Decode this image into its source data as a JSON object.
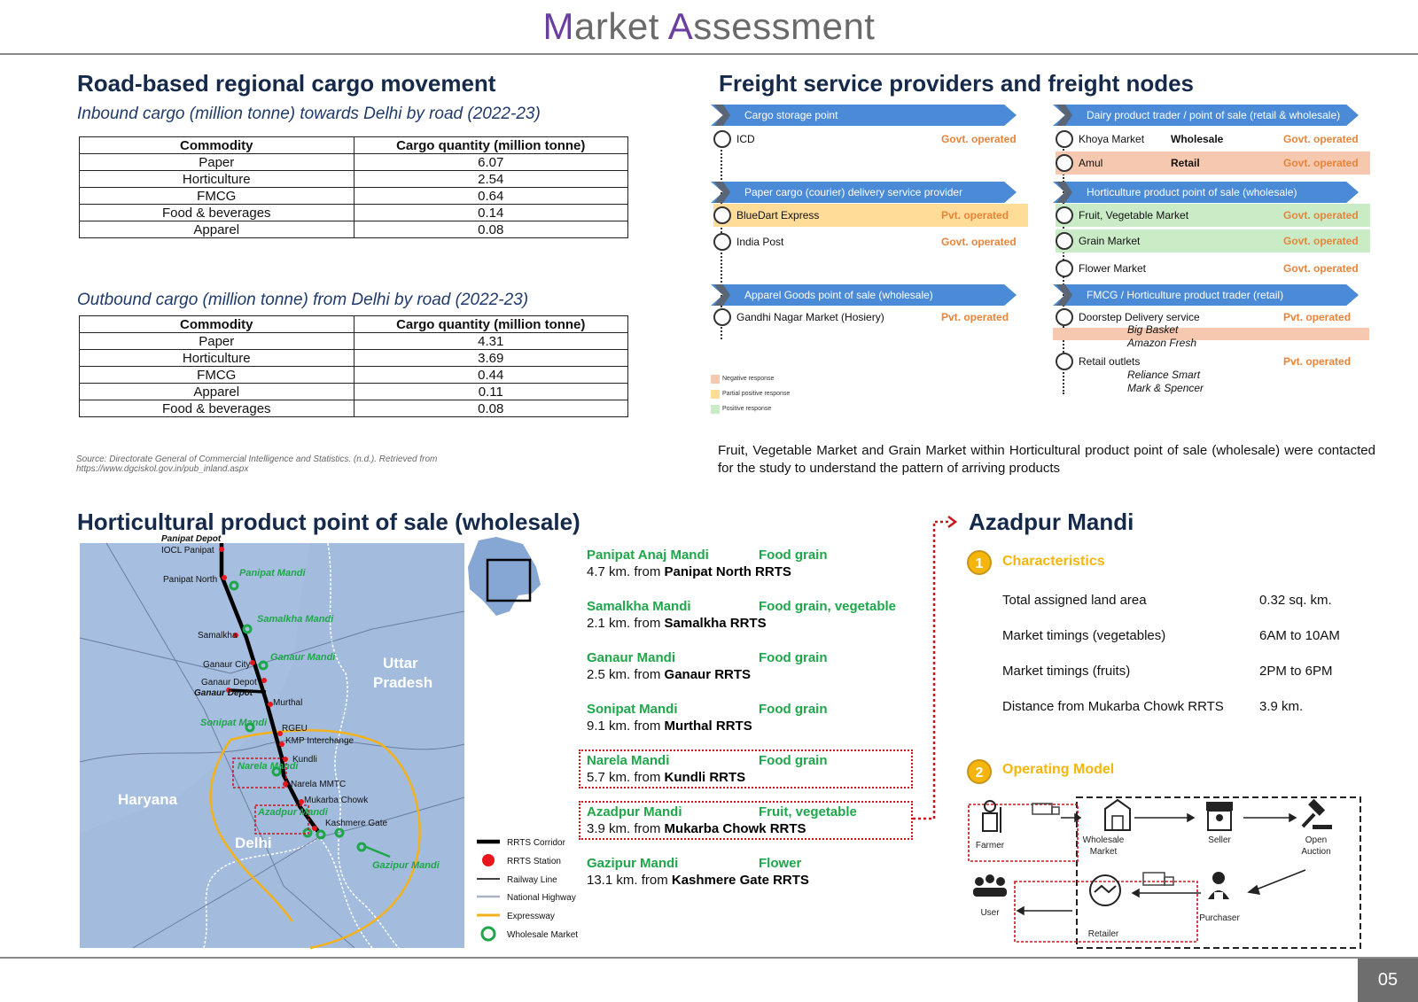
{
  "title": {
    "first_cap": "M",
    "first_rest": "arket ",
    "second_cap": "A",
    "second_rest": "ssessment"
  },
  "road_section": {
    "heading": "Road-based regional cargo movement",
    "inbound": {
      "subtitle": "Inbound cargo (million tonne) towards Delhi by road (2022-23)",
      "headers": [
        "Commodity",
        "Cargo quantity (million tonne)"
      ],
      "rows": [
        [
          "Paper",
          "6.07"
        ],
        [
          "Horticulture",
          "2.54"
        ],
        [
          "FMCG",
          "0.64"
        ],
        [
          "Food & beverages",
          "0.14"
        ],
        [
          "Apparel",
          "0.08"
        ]
      ]
    },
    "outbound": {
      "subtitle": "Outbound cargo (million tonne) from Delhi by road (2022-23)",
      "headers": [
        "Commodity",
        "Cargo quantity (million tonne)"
      ],
      "rows": [
        [
          "Paper",
          "4.31"
        ],
        [
          "Horticulture",
          "3.69"
        ],
        [
          "FMCG",
          "0.44"
        ],
        [
          "Apparel",
          "0.11"
        ],
        [
          "Food & beverages",
          "0.08"
        ]
      ]
    },
    "source_line1": "Source: Directorate General of Commercial Intelligence and Statistics. (n.d.). Retrieved from",
    "source_line2": "https://www.dgciskol.gov.in/pub_inland.aspx"
  },
  "freight": {
    "heading": "Freight service providers and freight nodes",
    "left_groups": [
      {
        "band": "Cargo storage point",
        "nodes": [
          {
            "name": "ICD",
            "op": "Govt. operated",
            "hl": ""
          }
        ]
      },
      {
        "band": "Paper cargo (courier) delivery service provider",
        "nodes": [
          {
            "name": "BlueDart Express",
            "op": "Pvt. operated",
            "hl": "#ffdd99"
          },
          {
            "name": "India Post",
            "op": "Govt. operated",
            "hl": ""
          }
        ]
      },
      {
        "band": "Apparel Goods point of sale (wholesale)",
        "nodes": [
          {
            "name": "Gandhi Nagar Market (Hosiery)",
            "op": "Pvt. operated",
            "hl": ""
          }
        ]
      }
    ],
    "right_groups": [
      {
        "band": "Dairy product trader / point of sale (retail & wholesale)",
        "nodes": [
          {
            "name": "Khoya Market",
            "mid": "Wholesale",
            "op": "Govt. operated",
            "hl": ""
          },
          {
            "name": "Amul",
            "mid": "Retail",
            "op": "Govt. operated",
            "hl": "#f6c8b0"
          }
        ]
      },
      {
        "band": "Horticulture product point of sale (wholesale)",
        "nodes": [
          {
            "name": "Fruit, Vegetable Market",
            "op": "Govt. operated",
            "hl": "#c9ecc7"
          },
          {
            "name": "Grain Market",
            "op": "Govt. operated",
            "hl": "#c9ecc7"
          },
          {
            "name": "Flower Market",
            "op": "Govt. operated",
            "hl": ""
          }
        ]
      },
      {
        "band": "FMCG / Horticulture product trader (retail)",
        "nodes": [
          {
            "name": "Doorstep Delivery service",
            "op": "Pvt. operated",
            "hl": ""
          },
          {
            "name": "Retail outlets",
            "op": "Pvt. operated",
            "hl": ""
          }
        ]
      }
    ],
    "doorstep_examples": [
      "Big Basket",
      "Amazon Fresh"
    ],
    "retail_examples": [
      "Reliance Smart",
      "Mark & Spencer"
    ],
    "legend": [
      {
        "label": "Negative response",
        "color": "#f6c8b0"
      },
      {
        "label": "Partial positive response",
        "color": "#ffdd99"
      },
      {
        "label": "Positive response",
        "color": "#c9ecc7"
      }
    ],
    "note": "Fruit, Vegetable Market and Grain Market within Horticultural product point of sale (wholesale) were contacted for the study to understand the pattern of arriving products"
  },
  "horti": {
    "heading": "Horticultural product point of sale (wholesale)",
    "map_labels": {
      "panipat_depot": "Panipat Depot",
      "iocl": "IOCL Panipat",
      "panipat_north": "Panipat North",
      "panipat_mandi": "Panipat Mandi",
      "samalkha": "Samalkha",
      "samalkha_mandi": "Samalkha Mandi",
      "ganaur_city": "Ganaur City",
      "ganaur_mandi": "Ganaur Mandi",
      "ganaur_depot": "Ganaur Depot",
      "ganaur_depot2": "Ganaur Depot",
      "murthal": "Murthal",
      "sonipat_mandi": "Sonipat Mandi",
      "rgeu": "RGEU",
      "kmp": "KMP Interchange",
      "kundli": "Kundli",
      "narela_mandi": "Narela Mandi",
      "narela_mmtc": "Narela MMTC",
      "mukarba": "Mukarba Chowk",
      "azadpur_mandi": "Azadpur Mandi",
      "kashmere": "Kashmere Gate",
      "gazipur_mandi": "Gazipur Mandi",
      "haryana": "Haryana",
      "delhi": "Delhi",
      "uttar": "Uttar",
      "pradesh": "Pradesh"
    },
    "map_legend": [
      "RRTS Corridor",
      "RRTS Station",
      "Railway Line",
      "National Highway",
      "Expressway",
      "Wholesale Market"
    ],
    "markets": [
      {
        "name": "Panipat Anaj Mandi",
        "type": "Food grain",
        "dist": "4.7 km. from ",
        "stn": "Panipat North RRTS",
        "boxed": false
      },
      {
        "name": "Samalkha Mandi",
        "type": "Food grain, vegetable",
        "dist": "2.1 km. from ",
        "stn": "Samalkha RRTS",
        "boxed": false
      },
      {
        "name": "Ganaur Mandi",
        "type": "Food grain",
        "dist": "2.5 km. from ",
        "stn": "Ganaur RRTS",
        "boxed": false
      },
      {
        "name": "Sonipat Mandi",
        "type": "Food grain",
        "dist": "9.1 km. from ",
        "stn": "Murthal RRTS",
        "boxed": false
      },
      {
        "name": "Narela Mandi",
        "type": "Food grain",
        "dist": "5.7 km. from ",
        "stn": "Kundli RRTS",
        "boxed": true
      },
      {
        "name": "Azadpur Mandi",
        "type": "Fruit, vegetable",
        "dist": "3.9 km. from ",
        "stn": "Mukarba Chowk RRTS",
        "boxed": true
      },
      {
        "name": "Gazipur Mandi",
        "type": "Flower",
        "dist": "13.1 km. from ",
        "stn": "Kashmere Gate RRTS",
        "boxed": false
      }
    ]
  },
  "azadpur": {
    "heading": "Azadpur Mandi",
    "sec1_num": "1",
    "sec1_title": "Characteristics",
    "chars": [
      {
        "label": "Total assigned land area",
        "value": "0.32 sq. km."
      },
      {
        "label": "Market timings (vegetables)",
        "value": "6AM to 10AM"
      },
      {
        "label": "Market timings (fruits)",
        "value": "2PM to 6PM"
      },
      {
        "label": "Distance from Mukarba Chowk RRTS",
        "value": "3.9 km."
      }
    ],
    "sec2_num": "2",
    "sec2_title": "Operating Model",
    "model": {
      "farmer": "Farmer",
      "wholesale1": "Wholesale",
      "wholesale2": "Market",
      "seller": "Seller",
      "auction1": "Open",
      "auction2": "Auction",
      "user": "User",
      "retailer": "Retailer",
      "purchaser": "Purchaser"
    }
  },
  "page_number": "05"
}
